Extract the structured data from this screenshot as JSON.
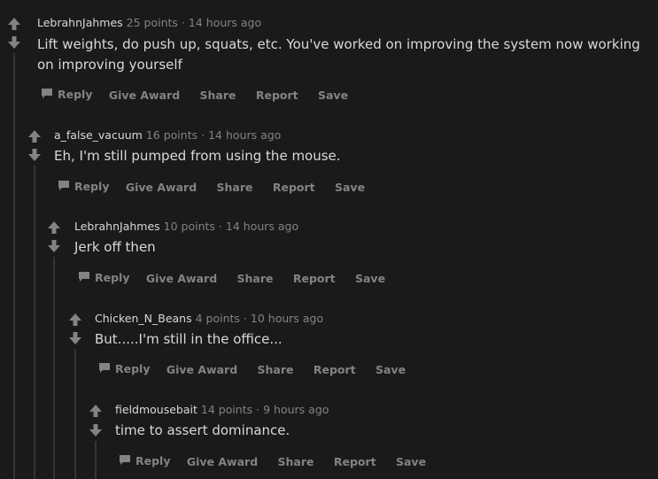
{
  "colors": {
    "background": "#1a1a1b",
    "text": "#d7dadc",
    "muted": "#818384",
    "thread_line": "#343536"
  },
  "actions": {
    "reply": "Reply",
    "give_award": "Give Award",
    "share": "Share",
    "report": "Report",
    "save": "Save"
  },
  "icons": {
    "upvote": "upvote-arrow-icon",
    "downvote": "downvote-arrow-icon",
    "reply": "comment-bubble-icon"
  },
  "comments": [
    {
      "author": "LebrahnJahmes",
      "points": "25 points",
      "separator": "·",
      "time": "14 hours ago",
      "body": "Lift weights, do push up, squats, etc. You've worked on improving the system now working on improving yourself"
    },
    {
      "author": "a_false_vacuum",
      "points": "16 points",
      "separator": "·",
      "time": "14 hours ago",
      "body": "Eh, I'm still pumped from using the mouse."
    },
    {
      "author": "LebrahnJahmes",
      "points": "10 points",
      "separator": "·",
      "time": "14 hours ago",
      "body": "Jerk off then"
    },
    {
      "author": "Chicken_N_Beans",
      "points": "4 points",
      "separator": "·",
      "time": "10 hours ago",
      "body": "But.....I'm still in the office..."
    },
    {
      "author": "fieldmousebait",
      "points": "14 points",
      "separator": "·",
      "time": "9 hours ago",
      "body": "time to assert dominance."
    }
  ]
}
